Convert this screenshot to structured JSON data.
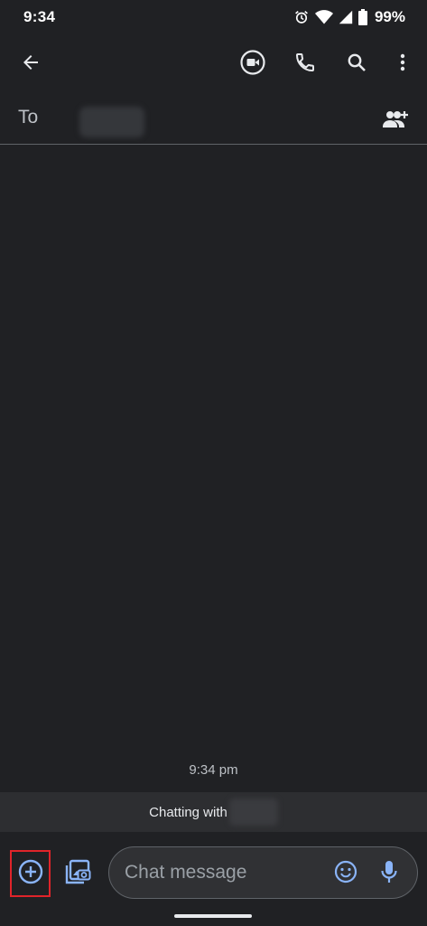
{
  "status_bar": {
    "time": "9:34",
    "battery": "99%",
    "icons": [
      "alarm-icon",
      "wifi-icon",
      "signal-icon",
      "battery-icon"
    ]
  },
  "app_bar": {
    "icons": [
      "back-arrow-icon",
      "video-call-icon",
      "phone-icon",
      "search-icon",
      "more-vert-icon"
    ]
  },
  "recipient": {
    "label": "To",
    "add_people_icon": "add-people-icon"
  },
  "conversation": {
    "timestamp": "9:34 pm",
    "chatting_with": "Chatting with"
  },
  "compose": {
    "placeholder": "Chat message",
    "value": "",
    "icons": [
      "add-circle-icon",
      "gallery-icon",
      "emoji-icon",
      "mic-icon"
    ]
  },
  "colors": {
    "background": "#202124",
    "accent": "#8ab4f8",
    "highlight": "#e0242a",
    "field": "#303134"
  }
}
